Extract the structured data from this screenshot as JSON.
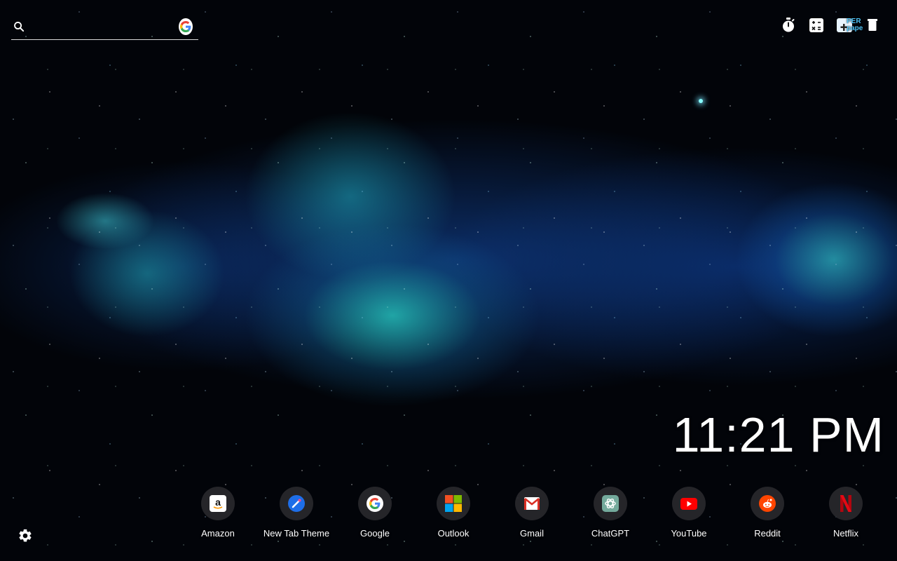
{
  "search": {
    "placeholder": "",
    "value": "",
    "engine_icon": "google-g-icon"
  },
  "toolbar": {
    "icons": [
      "stopwatch-icon",
      "calculator-icon",
      "wallpaper-promo-icon"
    ],
    "promo_text": "PER\npape"
  },
  "clock": {
    "time": "11:21 PM"
  },
  "shortcuts": [
    {
      "label": "Amazon",
      "icon": "amazon-icon"
    },
    {
      "label": "New Tab Theme",
      "icon": "new-tab-theme-icon"
    },
    {
      "label": "Google",
      "icon": "google-icon"
    },
    {
      "label": "Outlook",
      "icon": "microsoft-icon"
    },
    {
      "label": "Gmail",
      "icon": "gmail-icon"
    },
    {
      "label": "ChatGPT",
      "icon": "chatgpt-icon"
    },
    {
      "label": "YouTube",
      "icon": "youtube-icon"
    },
    {
      "label": "Reddit",
      "icon": "reddit-icon"
    },
    {
      "label": "Netflix",
      "icon": "netflix-icon"
    }
  ],
  "settings": {
    "icon": "gear-icon"
  },
  "colors": {
    "background": "#020409",
    "nebula_cyan": "#28d2c8",
    "nebula_blue": "#1450b4",
    "tile_bg": "#28282c"
  }
}
